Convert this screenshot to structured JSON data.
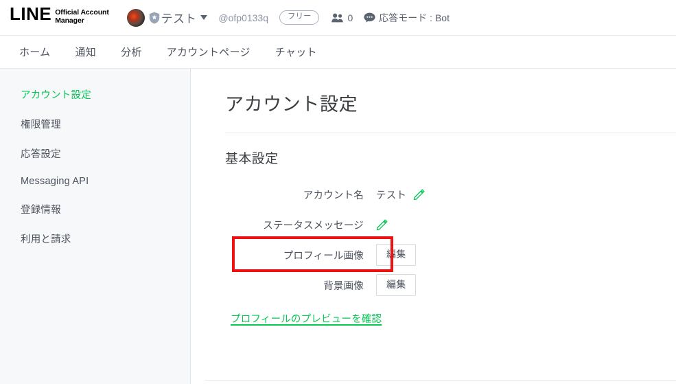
{
  "header": {
    "logo_main": "LINE",
    "logo_sub_line1": "Official Account",
    "logo_sub_line2": "Manager",
    "avatar_name": "avatar",
    "badge_name": "verified-shield-badge",
    "account_name": "テスト",
    "account_id": "@ofp0133q",
    "plan_badge": "フリー",
    "friends_count": "0",
    "response_mode": "応答モード : Bot"
  },
  "nav": {
    "items": [
      {
        "label": "ホーム"
      },
      {
        "label": "通知"
      },
      {
        "label": "分析"
      },
      {
        "label": "アカウントページ"
      },
      {
        "label": "チャット"
      }
    ]
  },
  "sidebar": {
    "items": [
      {
        "label": "アカウント設定",
        "active": true
      },
      {
        "label": "権限管理",
        "active": false
      },
      {
        "label": "応答設定",
        "active": false
      },
      {
        "label": "Messaging API",
        "active": false
      },
      {
        "label": "登録情報",
        "active": false
      },
      {
        "label": "利用と請求",
        "active": false
      }
    ]
  },
  "main": {
    "page_title": "アカウント設定",
    "section_title": "基本設定",
    "rows": [
      {
        "label": "アカウント名",
        "value": "テスト",
        "control": "pencil",
        "control_label": "",
        "highlighted": false
      },
      {
        "label": "ステータスメッセージ",
        "value": "",
        "control": "pencil",
        "control_label": "",
        "highlighted": false
      },
      {
        "label": "プロフィール画像",
        "value": "",
        "control": "button",
        "control_label": "編集",
        "highlighted": true
      },
      {
        "label": "背景画像",
        "value": "",
        "control": "button",
        "control_label": "編集",
        "highlighted": false
      }
    ],
    "preview_link": "プロフィールのプレビューを確認"
  },
  "colors": {
    "brand_green": "#06c755",
    "annotation_red": "#ee1111",
    "text_primary": "#3c4043",
    "text_secondary": "#4c525e",
    "muted_blue": "#5b6270",
    "sidebar_bg": "#f7f8f9",
    "border": "#e8eaed"
  }
}
